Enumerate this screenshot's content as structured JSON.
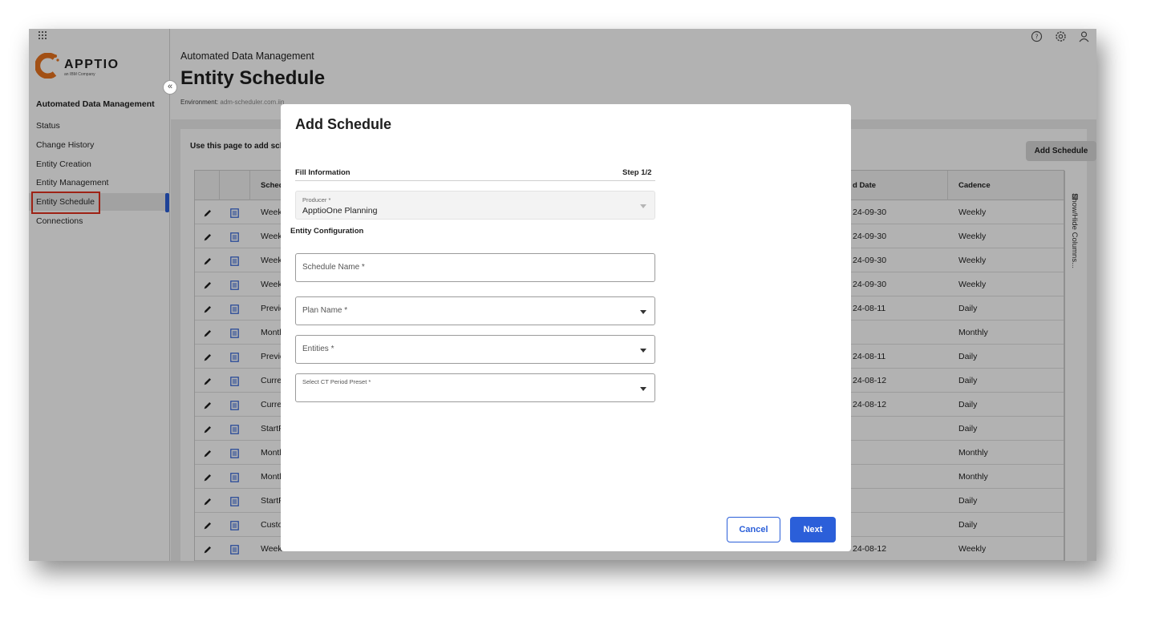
{
  "sidebar": {
    "title": "Automated Data Management",
    "logo_text": "APPTIO",
    "logo_sub": "an IBM Company",
    "items": [
      {
        "label": "Status"
      },
      {
        "label": "Change History"
      },
      {
        "label": "Entity Creation"
      },
      {
        "label": "Entity Management"
      },
      {
        "label": "Entity Schedule",
        "active": true
      },
      {
        "label": "Connections"
      }
    ]
  },
  "header": {
    "breadcrumb": "Automated Data Management",
    "title": "Entity Schedule",
    "environment_label": "Environment:",
    "environment_value": "adm-scheduler.com.iin",
    "icons": [
      "help-icon",
      "settings-icon",
      "user-icon"
    ]
  },
  "page": {
    "intro": "Use this page to add sch",
    "add_button": "Add Schedule",
    "show_hide_columns": "Show/Hide Columns..."
  },
  "table": {
    "columns": [
      "Sched",
      "d Date",
      "Cadence"
    ],
    "rows": [
      {
        "name": "Week",
        "date": "24-09-30",
        "cadence": "Weekly"
      },
      {
        "name": "Week",
        "date": "24-09-30",
        "cadence": "Weekly"
      },
      {
        "name": "Week",
        "date": "24-09-30",
        "cadence": "Weekly"
      },
      {
        "name": "Week",
        "date": "24-09-30",
        "cadence": "Weekly"
      },
      {
        "name": "Previo",
        "date": "24-08-11",
        "cadence": "Daily"
      },
      {
        "name": "Montl",
        "date": "",
        "cadence": "Monthly"
      },
      {
        "name": "Previo",
        "date": "24-08-11",
        "cadence": "Daily"
      },
      {
        "name": "Currei",
        "date": "24-08-12",
        "cadence": "Daily"
      },
      {
        "name": "Currei",
        "date": "24-08-12",
        "cadence": "Daily"
      },
      {
        "name": "StartF",
        "date": "",
        "cadence": "Daily"
      },
      {
        "name": "Montl",
        "date": "",
        "cadence": "Monthly"
      },
      {
        "name": "Montl",
        "date": "",
        "cadence": "Monthly"
      },
      {
        "name": "StartF",
        "date": "",
        "cadence": "Daily"
      },
      {
        "name": "Custo",
        "date": "",
        "cadence": "Daily"
      },
      {
        "name": "Weekl",
        "date": "24-08-12",
        "cadence": "Weekly"
      }
    ]
  },
  "modal": {
    "title": "Add Schedule",
    "fill_info": "Fill Information",
    "step": "Step 1/2",
    "producer_label": "Producer *",
    "producer_value": "ApptioOne Planning",
    "entity_config": "Entity Configuration",
    "schedule_name_label": "Schedule Name *",
    "plan_name_label": "Plan Name *",
    "entities_label": "Entities *",
    "ct_preset_label": "Select CT Period Preset *",
    "cancel": "Cancel",
    "next": "Next"
  },
  "colors": {
    "accent": "#2b5fd9",
    "highlight_outline": "#e3321f",
    "logo_orange": "#e8731f"
  }
}
